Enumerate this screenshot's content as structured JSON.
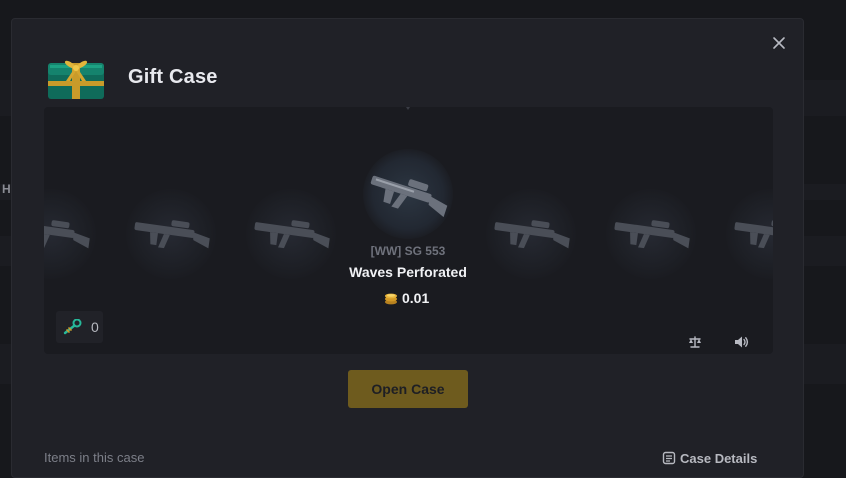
{
  "modal": {
    "title": "Gift Case",
    "close_icon": "close-icon",
    "case_icon": "gift-case-icon"
  },
  "spinner": {
    "items": [
      "rifle",
      "rifle",
      "rifle",
      "rifle",
      "rifle",
      "rifle",
      "rifle"
    ],
    "selected": {
      "name": "[WW] SG 553",
      "skin": "Waves Perforated",
      "price": "0.01",
      "coin_icon": "coin-stack-icon"
    },
    "key_count": "0",
    "key_icon": "key-icon",
    "compare_icon": "scale-icon",
    "sound_icon": "volume-icon"
  },
  "actions": {
    "open_case_label": "Open Case"
  },
  "footer": {
    "items_label": "Items in this case",
    "details_label": "Case Details"
  },
  "colors": {
    "accent": "#6e5b1e",
    "panel": "#202127",
    "spinner_bg": "#1a1b20"
  }
}
